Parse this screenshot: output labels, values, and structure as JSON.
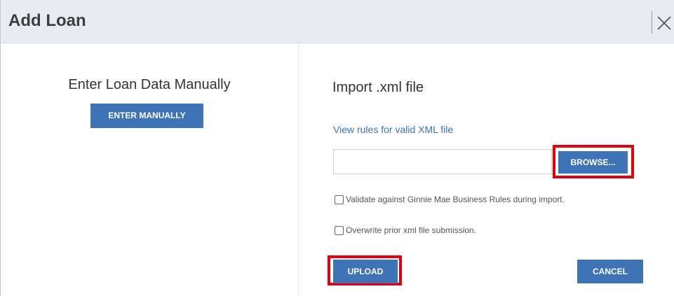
{
  "dialog": {
    "title": "Add Loan",
    "close_icon": "close-icon"
  },
  "left_panel": {
    "heading": "Enter Loan Data Manually",
    "enter_button": "ENTER MANUALLY"
  },
  "right_panel": {
    "heading": "Import .xml file",
    "rules_link": "View rules for valid XML file",
    "file_input_value": "",
    "browse_button": "BROWSE...",
    "validate_label": "Validate against Ginnie Mae Business Rules during import.",
    "overwrite_label": "Overwrite prior xml file submission.",
    "upload_button": "UPLOAD",
    "cancel_button": "CANCEL"
  },
  "colors": {
    "button_blue": "#3e73b6",
    "highlight_red": "#e3000f",
    "header_bg": "#e9ebf3",
    "link_blue": "#3a73b5"
  }
}
